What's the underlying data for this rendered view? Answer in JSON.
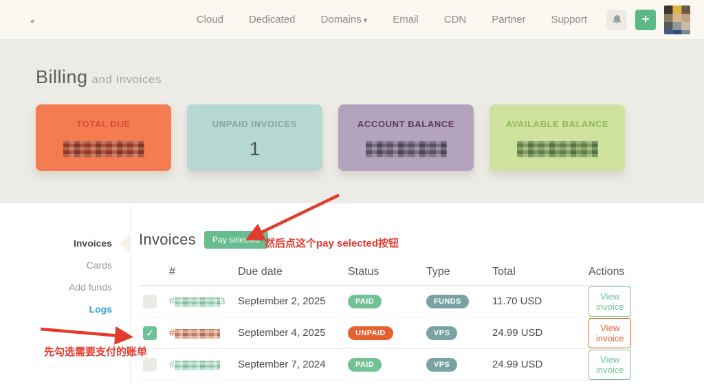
{
  "nav": {
    "links": [
      "Cloud",
      "Dedicated",
      "Domains",
      "Email",
      "CDN",
      "Partner",
      "Support"
    ],
    "domains_caret": "▾",
    "add_label": "+"
  },
  "page": {
    "title": "Billing",
    "subtitle": "and Invoices"
  },
  "cards": [
    {
      "label": "TOTAL DUE",
      "value": "",
      "redacted": true,
      "bg": "#f47c50",
      "label_color": "#d94a30"
    },
    {
      "label": "UNPAID INVOICES",
      "value": "1",
      "redacted": false,
      "bg": "#b7d8d2",
      "label_color": "#86a5a1"
    },
    {
      "label": "ACCOUNT BALANCE",
      "value": "",
      "redacted": true,
      "bg": "#b4a3bd",
      "label_color": "#5d3a56"
    },
    {
      "label": "AVAILABLE BALANCE",
      "value": "",
      "redacted": true,
      "bg": "#cfe29e",
      "label_color": "#8fba57"
    }
  ],
  "sidebar": {
    "items": [
      "Invoices",
      "Cards",
      "Add funds",
      "Logs"
    ],
    "active": "Invoices",
    "logs_color": "#39a0d0"
  },
  "main": {
    "heading": "Invoices",
    "pay_selected": "Pay selected",
    "check_glyph": "✓",
    "table": {
      "columns": {
        "number": "#",
        "due_date": "Due date",
        "status": "Status",
        "type": "Type",
        "total": "Total",
        "actions": "Actions"
      },
      "rows": [
        {
          "number": "#",
          "number_suffix": "3",
          "number_redacted": true,
          "due_date": "September 2, 2025",
          "status": "PAID",
          "type": "FUNDS",
          "total": "11.70 USD",
          "action": "View invoice",
          "checked": false
        },
        {
          "number": "#",
          "number_suffix": "",
          "number_redacted": true,
          "due_date": "September 4, 2025",
          "status": "UNPAID",
          "type": "VPS",
          "total": "24.99 USD",
          "action": "View invoice",
          "checked": true
        },
        {
          "number": "#",
          "number_suffix": "",
          "number_redacted": true,
          "due_date": "September 7, 2024",
          "status": "PAID",
          "type": "VPS",
          "total": "24.99 USD",
          "action": "View invoice",
          "checked": false
        }
      ]
    }
  },
  "annotations": {
    "note_pay": "然后点这个pay selected按钮",
    "note_check": "先勾选需要支付的账单",
    "color": "#e23b2e"
  },
  "colors": {
    "nav_bg": "#faf8f1",
    "band_bg": "#edebe5",
    "accent_green": "#5db888",
    "paid_badge": "#72c295",
    "unpaid_badge": "#e4602f",
    "type_badge": "#7aa2a3",
    "logs_link": "#39a0d0",
    "annotation_red": "#e23b2e"
  }
}
